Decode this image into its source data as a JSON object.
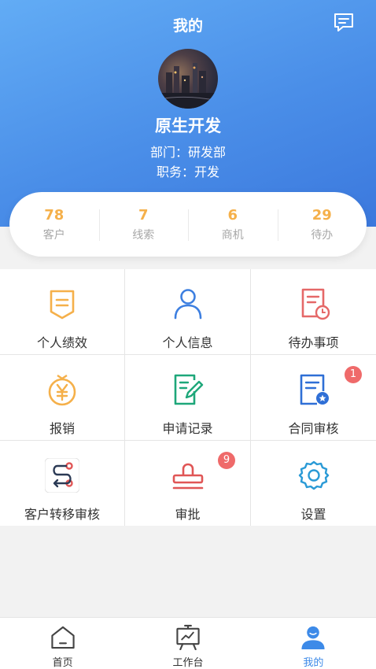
{
  "header": {
    "title": "我的"
  },
  "profile": {
    "name": "原生开发",
    "department": "部门：研发部",
    "position": "职务：开发"
  },
  "stats": [
    {
      "value": "78",
      "label": "客户"
    },
    {
      "value": "7",
      "label": "线索"
    },
    {
      "value": "6",
      "label": "商机"
    },
    {
      "value": "29",
      "label": "待办"
    }
  ],
  "menu": [
    {
      "label": "个人绩效",
      "icon": "performance-icon"
    },
    {
      "label": "个人信息",
      "icon": "person-icon"
    },
    {
      "label": "待办事项",
      "icon": "todo-clock-icon"
    },
    {
      "label": "报销",
      "icon": "yen-icon"
    },
    {
      "label": "申请记录",
      "icon": "edit-record-icon"
    },
    {
      "label": "合同审核",
      "icon": "contract-check-icon",
      "badge": "1"
    },
    {
      "label": "客户转移审核",
      "icon": "transfer-route-icon"
    },
    {
      "label": "审批",
      "icon": "stamp-icon",
      "badge": "9"
    },
    {
      "label": "设置",
      "icon": "gear-icon"
    }
  ],
  "tabs": [
    {
      "label": "首页",
      "icon": "home-icon"
    },
    {
      "label": "工作台",
      "icon": "workbench-icon"
    },
    {
      "label": "我的",
      "icon": "user-icon",
      "active": true
    }
  ],
  "colors": {
    "header_blue": "#4a8ee8",
    "stat_orange": "#f5b04a",
    "badge_red": "#ef6a6a",
    "active_tab": "#3d8ae8"
  }
}
